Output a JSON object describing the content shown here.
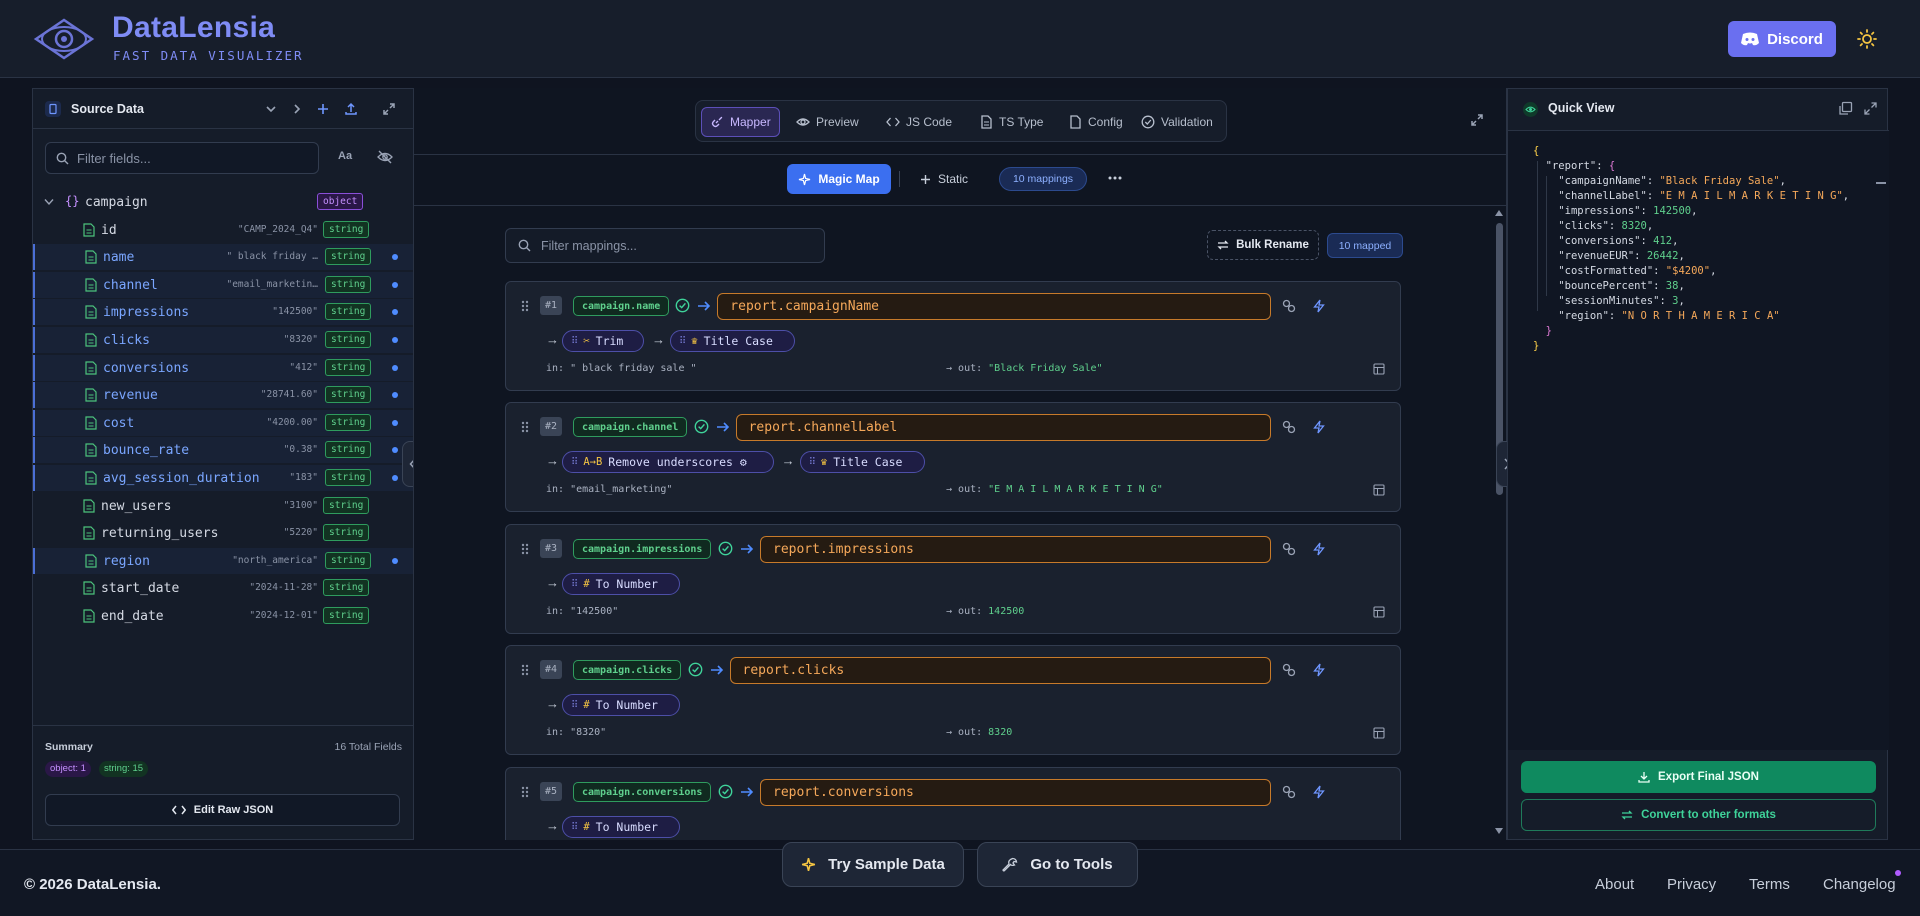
{
  "app": {
    "title": "DataLensia",
    "subtitle": "FAST DATA VISUALIZER"
  },
  "header": {
    "discord_label": "Discord"
  },
  "colors": {
    "accent": "#6a6ff0",
    "primary": "#3b6ff0",
    "success": "#0f8a5f",
    "target": "#f5a85a"
  },
  "source": {
    "title": "Source Data",
    "search_placeholder": "Filter fields...",
    "case_label": "Aa",
    "root": {
      "name": "campaign",
      "type": "object"
    },
    "fields": [
      {
        "name": "id",
        "value": "\"CAMP_2024_Q4\"",
        "type": "string",
        "mapped": false
      },
      {
        "name": "name",
        "value": "\" black friday …",
        "type": "string",
        "mapped": true
      },
      {
        "name": "channel",
        "value": "\"email_marketin…",
        "type": "string",
        "mapped": true
      },
      {
        "name": "impressions",
        "value": "\"142500\"",
        "type": "string",
        "mapped": true
      },
      {
        "name": "clicks",
        "value": "\"8320\"",
        "type": "string",
        "mapped": true
      },
      {
        "name": "conversions",
        "value": "\"412\"",
        "type": "string",
        "mapped": true
      },
      {
        "name": "revenue",
        "value": "\"28741.60\"",
        "type": "string",
        "mapped": true
      },
      {
        "name": "cost",
        "value": "\"4200.00\"",
        "type": "string",
        "mapped": true
      },
      {
        "name": "bounce_rate",
        "value": "\"0.38\"",
        "type": "string",
        "mapped": true
      },
      {
        "name": "avg_session_duration",
        "value": "\"183\"",
        "type": "string",
        "mapped": true
      },
      {
        "name": "new_users",
        "value": "\"3100\"",
        "type": "string",
        "mapped": false
      },
      {
        "name": "returning_users",
        "value": "\"5220\"",
        "type": "string",
        "mapped": false
      },
      {
        "name": "region",
        "value": "\"north_america\"",
        "type": "string",
        "mapped": true
      },
      {
        "name": "start_date",
        "value": "\"2024-11-28\"",
        "type": "string",
        "mapped": false
      },
      {
        "name": "end_date",
        "value": "\"2024-12-01\"",
        "type": "string",
        "mapped": false
      }
    ],
    "summary": {
      "title": "Summary",
      "total": "16 Total Fields",
      "object_chip": "object: 1",
      "string_chip": "string: 15"
    },
    "raw_button": "Edit Raw JSON"
  },
  "tabs": [
    "Mapper",
    "Preview",
    "JS Code",
    "TS Type",
    "Config",
    "Validation"
  ],
  "toolbar": {
    "magic": "Magic Map",
    "static": "Static",
    "count": "10 mappings"
  },
  "mapper": {
    "filter_placeholder": "Filter mappings...",
    "bulk": "Bulk Rename",
    "mapped": "10 mapped",
    "cards": [
      {
        "num": "#1",
        "source": "campaign.name",
        "target": "report.campaignName",
        "transforms": [
          {
            "icon": "✂",
            "label": "Trim"
          },
          {
            "icon": "♛",
            "label": "Title Case"
          }
        ],
        "in": "in: \" black friday sale \"",
        "out": "\"Black Friday Sale\""
      },
      {
        "num": "#2",
        "source": "campaign.channel",
        "target": "report.channelLabel",
        "transforms": [
          {
            "icon": "A→B",
            "label": "Remove underscores ⚙"
          },
          {
            "icon": "♛",
            "label": "Title Case"
          }
        ],
        "in": "in: \"email_marketing\"",
        "out": "\"E M A I L M A R K E T I N G\""
      },
      {
        "num": "#3",
        "source": "campaign.impressions",
        "target": "report.impressions",
        "transforms": [
          {
            "icon": "#",
            "label": "To Number"
          }
        ],
        "in": "in: \"142500\"",
        "out": "142500"
      },
      {
        "num": "#4",
        "source": "campaign.clicks",
        "target": "report.clicks",
        "transforms": [
          {
            "icon": "#",
            "label": "To Number"
          }
        ],
        "in": "in: \"8320\"",
        "out": "8320"
      },
      {
        "num": "#5",
        "source": "campaign.conversions",
        "target": "report.conversions",
        "transforms": [
          {
            "icon": "#",
            "label": "To Number"
          }
        ],
        "in": "",
        "out": ""
      }
    ],
    "out_prefix": "out: "
  },
  "quick_view": {
    "title": "Quick View",
    "root_key": "report",
    "entries": [
      {
        "key": "campaignName",
        "value": "\"Black Friday Sale\"",
        "kind": "string"
      },
      {
        "key": "channelLabel",
        "value": "\"E M A I L M A R K E T I N G\"",
        "kind": "string"
      },
      {
        "key": "impressions",
        "value": "142500",
        "kind": "number"
      },
      {
        "key": "clicks",
        "value": "8320",
        "kind": "number"
      },
      {
        "key": "conversions",
        "value": "412",
        "kind": "number"
      },
      {
        "key": "revenueEUR",
        "value": "26442",
        "kind": "number"
      },
      {
        "key": "costFormatted",
        "value": "\"$4200\"",
        "kind": "string"
      },
      {
        "key": "bouncePercent",
        "value": "38",
        "kind": "number"
      },
      {
        "key": "sessionMinutes",
        "value": "3",
        "kind": "number"
      },
      {
        "key": "region",
        "value": "\"N O R T H A M E R I C A\"",
        "kind": "string"
      }
    ],
    "export": "Export Final JSON",
    "convert": "Convert to other formats"
  },
  "footer": {
    "copyright": "© 2026 DataLensia.",
    "sample": "Try Sample Data",
    "tools": "Go to Tools",
    "links": [
      "About",
      "Privacy",
      "Terms",
      "Changelog"
    ]
  }
}
